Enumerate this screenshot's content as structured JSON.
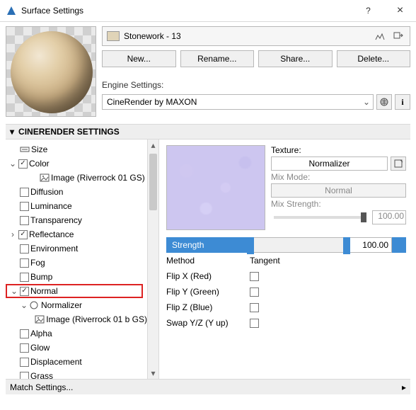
{
  "titlebar": {
    "title": "Surface Settings",
    "help": "?",
    "close": "×"
  },
  "material": {
    "name": "Stonework - 13"
  },
  "buttons": {
    "new": "New...",
    "rename": "Rename...",
    "share": "Share...",
    "delete": "Delete..."
  },
  "engine": {
    "label": "Engine Settings:",
    "selected": "CineRender by MAXON"
  },
  "section": {
    "cinerender": "CINERENDER SETTINGS"
  },
  "tree": {
    "size": "Size",
    "color": "Color",
    "color_image": "Image (Riverrock 01 GS)",
    "diffusion": "Diffusion",
    "luminance": "Luminance",
    "transparency": "Transparency",
    "reflectance": "Reflectance",
    "environment": "Environment",
    "fog": "Fog",
    "bump": "Bump",
    "normal": "Normal",
    "normalizer": "Normalizer",
    "normal_image": "Image (Riverrock 01 b GS)",
    "alpha": "Alpha",
    "glow": "Glow",
    "displacement": "Displacement",
    "grass": "Grass"
  },
  "detail": {
    "texture_label": "Texture:",
    "texture_value": "Normalizer",
    "mixmode_label": "Mix Mode:",
    "mixmode_value": "Normal",
    "mixstr_label": "Mix Strength:",
    "mixstr_value": "100.00",
    "strength_label": "Strength",
    "strength_value": "100.00",
    "method_label": "Method",
    "method_value": "Tangent",
    "flipx": "Flip X (Red)",
    "flipy": "Flip Y (Green)",
    "flipz": "Flip Z (Blue)",
    "swap": "Swap Y/Z (Y up)"
  },
  "footer": {
    "match": "Match Settings..."
  }
}
